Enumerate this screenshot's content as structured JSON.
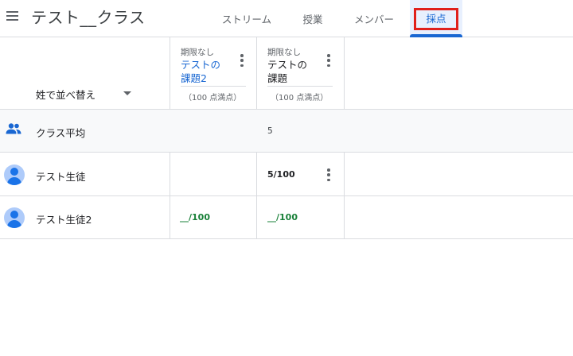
{
  "header": {
    "class_title": "テスト__クラス",
    "tabs": [
      {
        "label": "ストリーム",
        "active": false
      },
      {
        "label": "授業",
        "active": false
      },
      {
        "label": "メンバー",
        "active": false
      },
      {
        "label": "採点",
        "active": true
      }
    ]
  },
  "colors": {
    "accent": "#1967d2",
    "active_tab_bg": "#e8f0fe",
    "highlight_box": "#e0201c",
    "missing_grade": "#188038",
    "avatar_bg": "#aecbfa"
  },
  "gradebook": {
    "sort_label": "姓で並べ替え",
    "assignments": [
      {
        "due": "期限なし",
        "title_line1": "テストの",
        "title_line2": "課題2",
        "points": "（100 点満点）",
        "style": "link"
      },
      {
        "due": "期限なし",
        "title_line1": "テストの",
        "title_line2": "課題",
        "points": "（100 点満点）",
        "style": "plain"
      }
    ],
    "class_average": {
      "label": "クラス平均",
      "icon": "people-icon",
      "values": [
        "",
        "5"
      ]
    },
    "students": [
      {
        "name": "テスト生徒",
        "icon": "avatar-icon",
        "grades": [
          "",
          "5/100"
        ]
      },
      {
        "name": "テスト生徒2",
        "icon": "avatar-icon",
        "grades": [
          "__/100",
          "__/100"
        ]
      }
    ]
  }
}
